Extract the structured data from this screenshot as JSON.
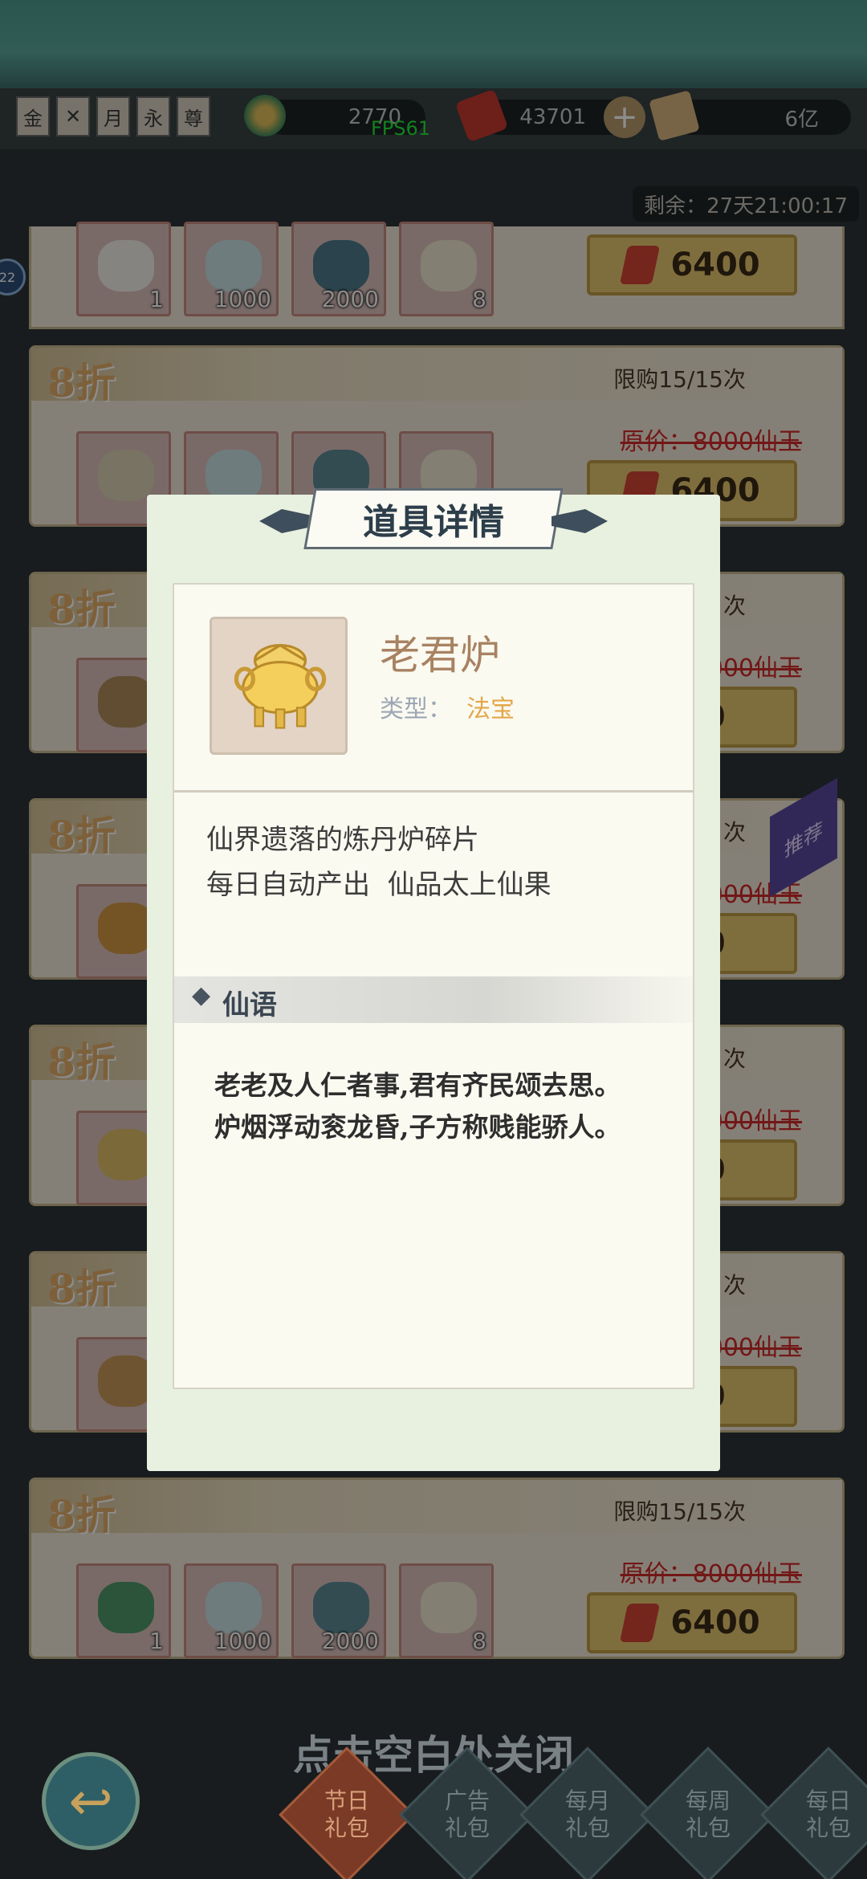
{
  "header": {
    "badges": [
      "金",
      "✕",
      "月",
      "永",
      "尊"
    ],
    "fps": "FPS61",
    "resources": [
      {
        "icon": "swirl-currency-icon",
        "value": "2770"
      },
      {
        "icon": "red-jade-icon",
        "value": "43701"
      },
      {
        "icon": "scroll-currency-icon",
        "value": "6亿"
      }
    ],
    "timer": "剩余：27天21:00:17",
    "side_badge": "22"
  },
  "shop": {
    "top_card": {
      "quantities": [
        "1",
        "1000",
        "2000",
        "8"
      ],
      "price": "6400"
    },
    "cards": [
      {
        "discount": "8折",
        "limit": "限购15/15次",
        "original": "原价：8000仙玉",
        "price": "6400",
        "quantities": [
          "",
          "",
          "",
          ""
        ]
      },
      {
        "discount": "8折",
        "limit": "",
        "original": "",
        "price": "",
        "quantities": [
          ""
        ]
      },
      {
        "discount": "8折",
        "limit": "",
        "original": "",
        "price": "",
        "quantities": [
          ""
        ]
      },
      {
        "discount": "8折",
        "limit": "",
        "original": "",
        "price": "",
        "quantities": [
          ""
        ]
      },
      {
        "discount": "8折",
        "limit": "",
        "original": "",
        "price": "",
        "quantities": [
          ""
        ]
      },
      {
        "discount": "8折",
        "limit": "限购15/15次",
        "original": "原价：8000仙玉",
        "price": "6400",
        "quantities": [
          "1",
          "1000",
          "2000",
          "8"
        ]
      }
    ],
    "partials": {
      "limit_suffix": "次",
      "orig_suffix": "000仙玉",
      "price_suffix": "400",
      "recommend_tag": "推荐"
    }
  },
  "dialog": {
    "title": "道具详情",
    "item_name": "老君炉",
    "type_label": "类型：",
    "type_value": "法宝",
    "description_lines": [
      "仙界遗落的炼丹炉碎片",
      "每日自动产出  仙品太上仙果"
    ],
    "quote_title": "仙语",
    "poem_lines": [
      "老老及人仁者事,君有齐民颂去思。",
      "炉烟浮动衮龙昏,子方称贱能骄人。"
    ]
  },
  "footer": {
    "close_hint": "点击空白处关闭",
    "tabs": [
      {
        "line1": "节日",
        "line2": "礼包",
        "active": true
      },
      {
        "line1": "广告",
        "line2": "礼包",
        "active": false
      },
      {
        "line1": "每月",
        "line2": "礼包",
        "active": false
      },
      {
        "line1": "每周",
        "line2": "礼包",
        "active": false
      },
      {
        "line1": "每日",
        "line2": "礼包",
        "active": false
      }
    ]
  }
}
